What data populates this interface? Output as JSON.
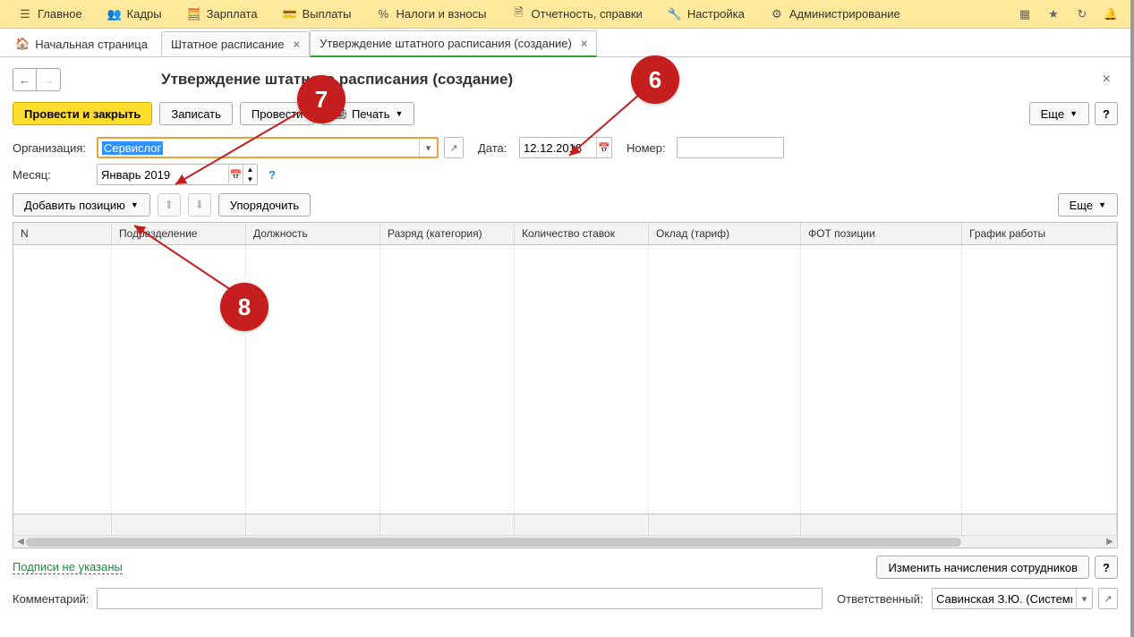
{
  "topmenu": {
    "main": "Главное",
    "hr": "Кадры",
    "salary": "Зарплата",
    "payments": "Выплаты",
    "taxes": "Налоги и взносы",
    "reports": "Отчетность, справки",
    "settings": "Настройка",
    "admin": "Администрирование"
  },
  "tabs": {
    "home": "Начальная страница",
    "t1": "Штатное расписание",
    "t2": "Утверждение штатного расписания (создание)"
  },
  "page": {
    "title": "Утверждение штатного расписания (создание)"
  },
  "toolbar": {
    "post_close": "Провести и закрыть",
    "save": "Записать",
    "post": "Провести",
    "print": "Печать",
    "more": "Еще",
    "help": "?"
  },
  "form": {
    "org_label": "Организация:",
    "org_value": "Сервислог",
    "date_label": "Дата:",
    "date_value": "12.12.2018",
    "number_label": "Номер:",
    "number_value": "",
    "month_label": "Месяц:",
    "month_value": "Январь 2019"
  },
  "toolbar2": {
    "add_position": "Добавить позицию",
    "order": "Упорядочить",
    "more": "Еще"
  },
  "grid": {
    "columns": [
      "N",
      "Подразделение",
      "Должность",
      "Разряд (категория)",
      "Количество ставок",
      "Оклад (тариф)",
      "ФОТ позиции",
      "График работы"
    ]
  },
  "link": {
    "signatures": "Подписи не указаны",
    "change_accruals": "Изменить начисления сотрудников"
  },
  "bottom": {
    "comment_label": "Комментарий:",
    "responsible_label": "Ответственный:",
    "responsible_value": "Савинская З.Ю. (Системн"
  },
  "annotations": {
    "a6": "6",
    "a7": "7",
    "a8": "8"
  }
}
